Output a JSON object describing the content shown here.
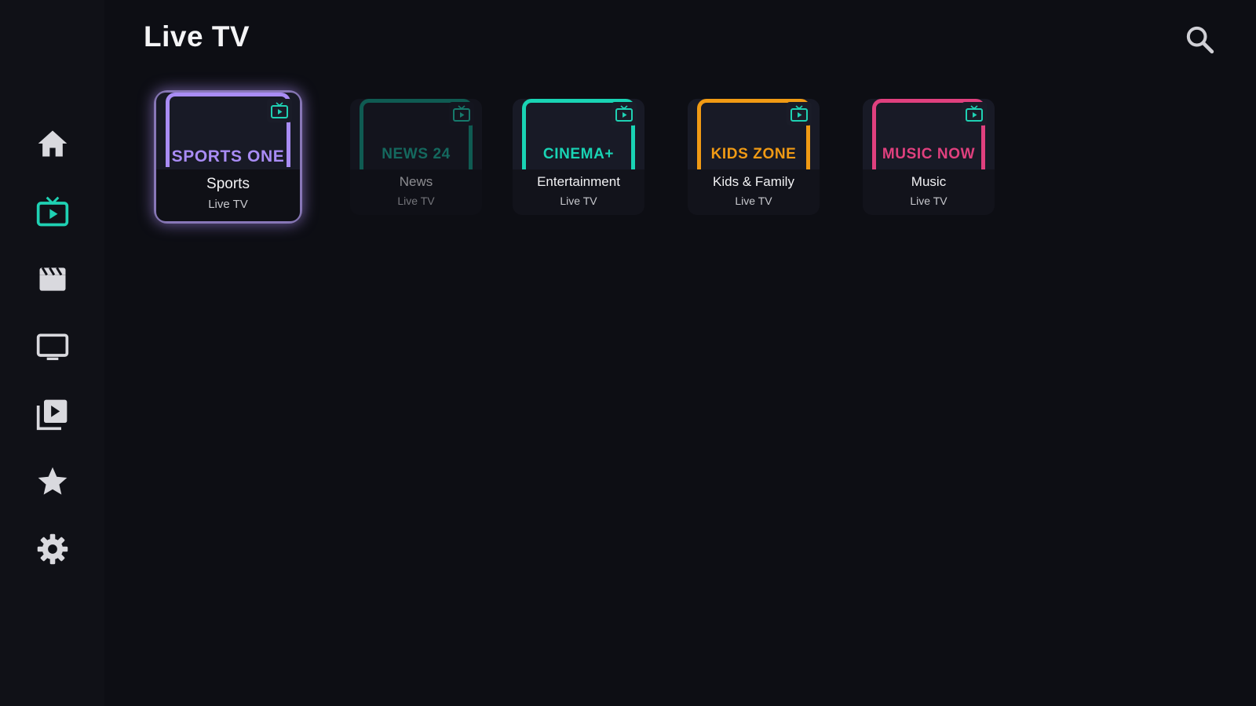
{
  "header": {
    "title": "Live TV"
  },
  "sidebar": {
    "items": [
      {
        "icon": "home-icon"
      },
      {
        "icon": "live-tv-icon"
      },
      {
        "icon": "movies-icon"
      },
      {
        "icon": "tv-shows-icon"
      },
      {
        "icon": "playlist-icon"
      },
      {
        "icon": "favorites-icon"
      },
      {
        "icon": "settings-icon"
      }
    ],
    "active": "live-tv-icon"
  },
  "colors": {
    "accent": "#1fd1b3",
    "sports": "#a98cf5",
    "news": "#129a86",
    "cinema": "#19d3b4",
    "kids": "#f09a14",
    "music": "#e0407e"
  },
  "channels": [
    {
      "brand": "SPORTS ONE",
      "genre": "Sports",
      "sub": "Live TV",
      "color": "#a98cf5",
      "focused": true
    },
    {
      "brand": "NEWS 24",
      "genre": "News",
      "sub": "Live TV",
      "color": "#129a86",
      "focused": false
    },
    {
      "brand": "CINEMA+",
      "genre": "Entertainment",
      "sub": "Live TV",
      "color": "#19d3b4",
      "focused": false
    },
    {
      "brand": "KIDS ZONE",
      "genre": "Kids & Family",
      "sub": "Live TV",
      "color": "#f09a14",
      "focused": false
    },
    {
      "brand": "MUSIC NOW",
      "genre": "Music",
      "sub": "Live TV",
      "color": "#e0407e",
      "focused": false
    }
  ]
}
